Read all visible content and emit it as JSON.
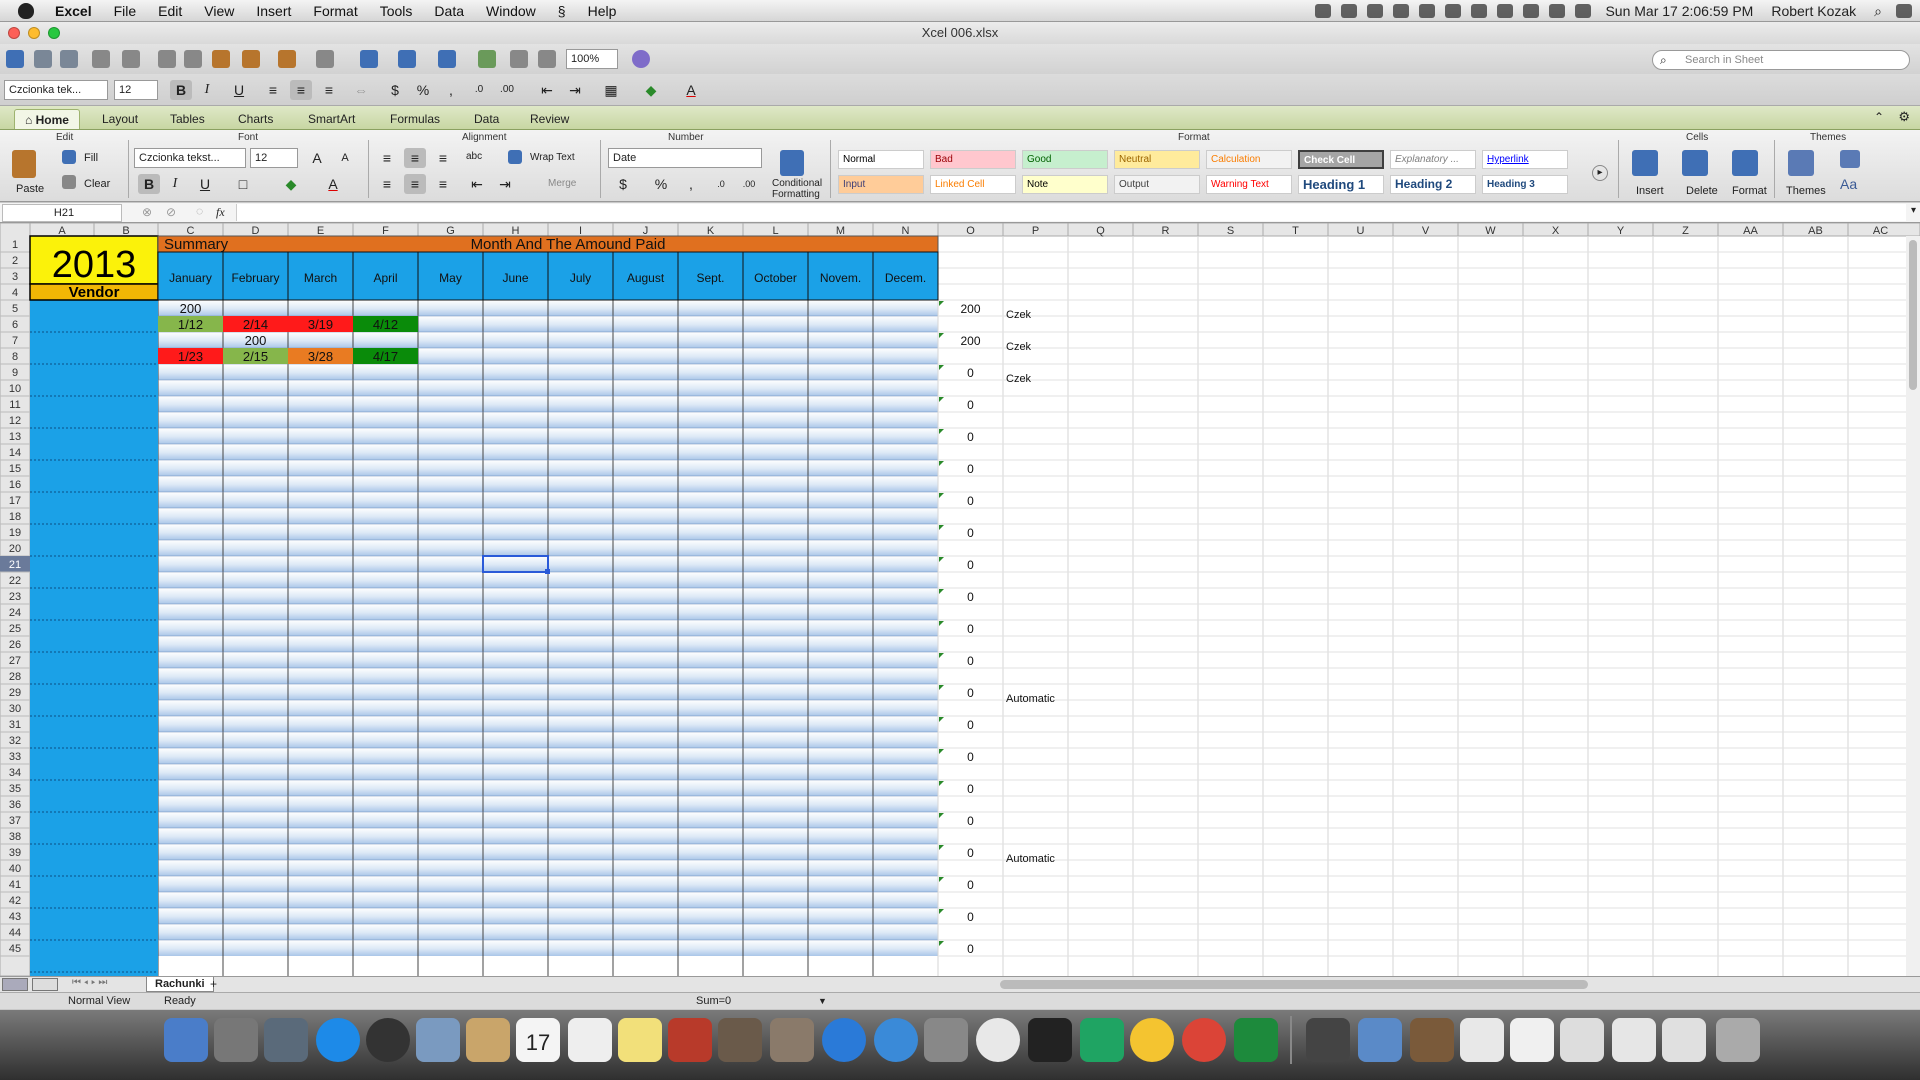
{
  "menubar": {
    "app": "Excel",
    "items": [
      "File",
      "Edit",
      "View",
      "Insert",
      "Format",
      "Tools",
      "Data",
      "Window",
      "Help"
    ],
    "clock": "Sun Mar 17  2:06:59 PM",
    "user": "Robert Kozak"
  },
  "window": {
    "title": "Xcel 006.xlsx"
  },
  "toolbar": {
    "zoom": "100%",
    "search_placeholder": "Search in Sheet",
    "font_name": "Czcionka tek...",
    "font_size": "12"
  },
  "ribbon_tabs": [
    "Home",
    "Layout",
    "Tables",
    "Charts",
    "SmartArt",
    "Formulas",
    "Data",
    "Review"
  ],
  "ribbon": {
    "groups": {
      "edit": "Edit",
      "font": "Font",
      "alignment": "Alignment",
      "number": "Number",
      "format": "Format",
      "cells": "Cells",
      "themes": "Themes"
    },
    "paste": "Paste",
    "fill": "Fill",
    "clear": "Clear",
    "font_name": "Czcionka tekst...",
    "font_size": "12",
    "wrap_text": "Wrap Text",
    "merge": "Merge",
    "abc": "abc",
    "number_format": "Date",
    "conditional": "Conditional",
    "formatting": "Formatting",
    "styles": [
      {
        "label": "Normal",
        "bg": "#ffffff",
        "fg": "#000000"
      },
      {
        "label": "Bad",
        "bg": "#ffc7ce",
        "fg": "#9c0006"
      },
      {
        "label": "Good",
        "bg": "#c6efce",
        "fg": "#006100"
      },
      {
        "label": "Neutral",
        "bg": "#ffeb9c",
        "fg": "#9c6500"
      },
      {
        "label": "Calculation",
        "bg": "#f2f2f2",
        "fg": "#fa7d00"
      },
      {
        "label": "Check Cell",
        "bg": "#a5a5a5",
        "fg": "#ffffff"
      },
      {
        "label": "Explanatory ...",
        "bg": "#ffffff",
        "fg": "#7f7f7f"
      },
      {
        "label": "Hyperlink",
        "bg": "#ffffff",
        "fg": "#0000ff"
      },
      {
        "label": "Input",
        "bg": "#ffcc99",
        "fg": "#3f3f76"
      },
      {
        "label": "Linked Cell",
        "bg": "#ffffff",
        "fg": "#fa7d00"
      },
      {
        "label": "Note",
        "bg": "#ffffcc",
        "fg": "#000000"
      },
      {
        "label": "Output",
        "bg": "#f2f2f2",
        "fg": "#3f3f3f"
      },
      {
        "label": "Warning Text",
        "bg": "#ffffff",
        "fg": "#ff0000"
      },
      {
        "label": "Heading 1",
        "bg": "#ffffff",
        "fg": "#1f497d"
      },
      {
        "label": "Heading 2",
        "bg": "#ffffff",
        "fg": "#1f497d"
      },
      {
        "label": "Heading 3",
        "bg": "#ffffff",
        "fg": "#1f497d"
      }
    ],
    "insert": "Insert",
    "delete": "Delete",
    "format": "Format",
    "themes": "Themes",
    "aa": "Aa"
  },
  "formula_bar": {
    "cell_ref": "H21",
    "fx": "fx",
    "value": ""
  },
  "sheet": {
    "col_headers": [
      "A",
      "B",
      "C",
      "D",
      "E",
      "F",
      "G",
      "H",
      "I",
      "J",
      "K",
      "L",
      "M",
      "N",
      "O",
      "P",
      "Q",
      "R",
      "S",
      "T",
      "U",
      "V",
      "W",
      "X",
      "Y",
      "Z",
      "AA",
      "AB",
      "AC"
    ],
    "year": "2013",
    "vendor": "Vendor",
    "summary": "Summary",
    "header_title": "Month And The Amound Paid",
    "months": [
      "January",
      "February",
      "March",
      "April",
      "May",
      "June",
      "July",
      "August",
      "Sept.",
      "October",
      "Novem.",
      "Decem."
    ],
    "colors": {
      "yellow": "#fbf20a",
      "orange": "#e0701f",
      "blue": "#1ba1e7",
      "red": "#ff1a1a",
      "green": "#0a8b0a",
      "lightgreen": "#86b64b",
      "lightorange": "#e97b22"
    },
    "cells": [
      {
        "row": 5,
        "col": 2,
        "text": "200",
        "bg": ""
      },
      {
        "row": 6,
        "col": 2,
        "text": "1/12",
        "bg": "lightgreen"
      },
      {
        "row": 6,
        "col": 3,
        "text": "2/14",
        "bg": "red"
      },
      {
        "row": 6,
        "col": 4,
        "text": "3/19",
        "bg": "red"
      },
      {
        "row": 6,
        "col": 5,
        "text": "4/12",
        "bg": "green"
      },
      {
        "row": 7,
        "col": 3,
        "text": "200",
        "bg": ""
      },
      {
        "row": 8,
        "col": 2,
        "text": "1/23",
        "bg": "red"
      },
      {
        "row": 8,
        "col": 3,
        "text": "2/15",
        "bg": "lightgreen"
      },
      {
        "row": 8,
        "col": 4,
        "text": "3/28",
        "bg": "lightorange"
      },
      {
        "row": 8,
        "col": 5,
        "text": "4/17",
        "bg": "green"
      }
    ],
    "o_values": [
      {
        "row": 5,
        "value": "200"
      },
      {
        "row": 7,
        "value": "200"
      },
      {
        "row": 9,
        "value": "0"
      },
      {
        "row": 11,
        "value": "0"
      },
      {
        "row": 13,
        "value": "0"
      },
      {
        "row": 15,
        "value": "0"
      },
      {
        "row": 17,
        "value": "0"
      },
      {
        "row": 19,
        "value": "0"
      },
      {
        "row": 21,
        "value": "0"
      },
      {
        "row": 23,
        "value": "0"
      },
      {
        "row": 25,
        "value": "0"
      },
      {
        "row": 27,
        "value": "0"
      },
      {
        "row": 29,
        "value": "0"
      },
      {
        "row": 31,
        "value": "0"
      },
      {
        "row": 33,
        "value": "0"
      },
      {
        "row": 35,
        "value": "0"
      },
      {
        "row": 37,
        "value": "0"
      },
      {
        "row": 39,
        "value": "0"
      },
      {
        "row": 41,
        "value": "0"
      },
      {
        "row": 43,
        "value": "0"
      },
      {
        "row": 45,
        "value": "0"
      }
    ],
    "p_values": [
      {
        "row": 5,
        "value": "Czek"
      },
      {
        "row": 7,
        "value": "Czek"
      },
      {
        "row": 9,
        "value": "Czek"
      },
      {
        "row": 29,
        "value": "Automatic"
      },
      {
        "row": 39,
        "value": "Automatic"
      }
    ],
    "selected": {
      "row": 21,
      "col": 7
    }
  },
  "sheet_tabs": [
    "Rachunki"
  ],
  "statusbar": {
    "view": "Normal View",
    "ready": "Ready",
    "sum": "Sum=0"
  },
  "dock": {
    "calendar_day": "17"
  }
}
